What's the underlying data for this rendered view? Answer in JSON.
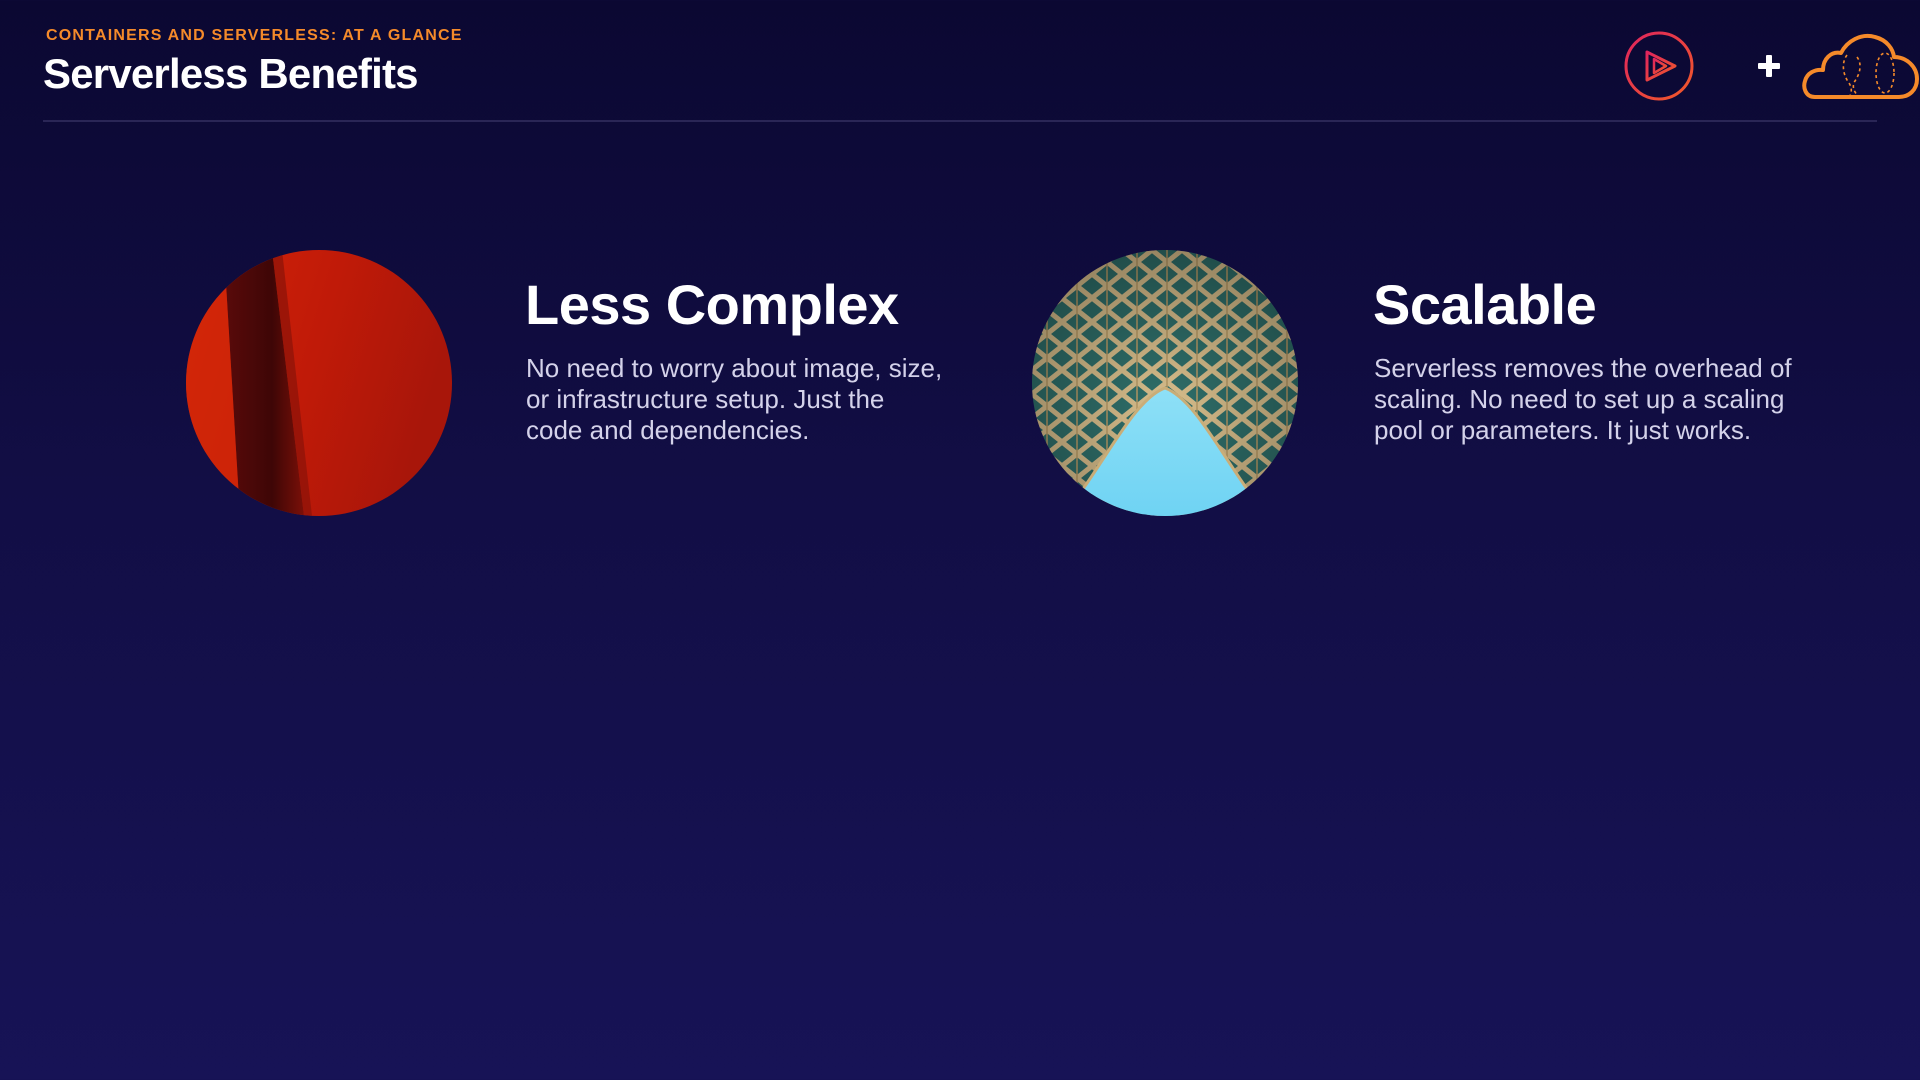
{
  "header": {
    "eyebrow": "CONTAINERS AND SERVERLESS: AT A GLANCE",
    "title": "Serverless Benefits"
  },
  "logos": {
    "left_icon": "play-circle-icon",
    "separator_icon": "plus-icon",
    "right_icon": "cloud-icon",
    "colors": {
      "play": "#e0245e",
      "play_gradient_end": "#f05a28",
      "cloud": "#f58a2a"
    }
  },
  "benefits": [
    {
      "title": "Less Complex",
      "body": "No need to worry about image, size, or infrastructure setup. Just the code and dependencies.",
      "image": "red-abstract-photo"
    },
    {
      "title": "Scalable",
      "body": "Serverless removes the overhead of scaling. No need to set up a scaling pool or parameters. It just works.",
      "image": "lattice-arch-photo"
    }
  ],
  "colors": {
    "background_top": "#0b0832",
    "background_bottom": "#171356",
    "accent": "#f58a2a",
    "body_text": "#d4d2ea"
  }
}
